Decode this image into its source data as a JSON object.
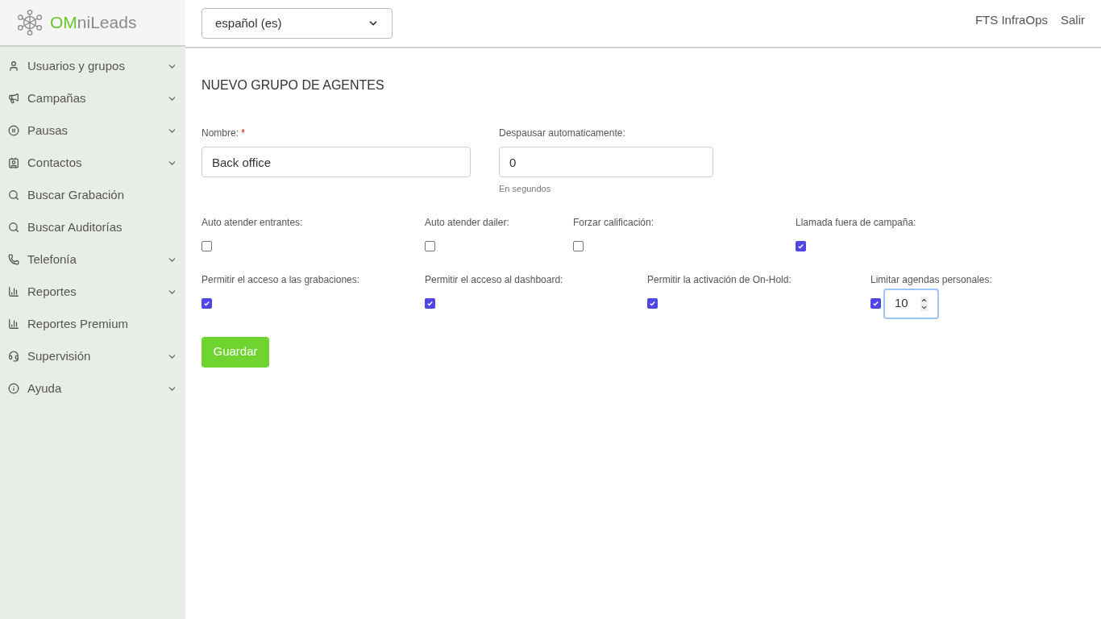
{
  "logo": {
    "accent": "OM",
    "rest": "niLeads"
  },
  "language_select": {
    "value": "español (es)"
  },
  "top_links": [
    "FTS InfraOps",
    "Salir"
  ],
  "sidebar": {
    "items": [
      {
        "label": "Usuarios y grupos",
        "expandable": true
      },
      {
        "label": "Campañas",
        "expandable": true
      },
      {
        "label": "Pausas",
        "expandable": true
      },
      {
        "label": "Contactos",
        "expandable": true
      },
      {
        "label": "Buscar Grabación",
        "expandable": false
      },
      {
        "label": "Buscar Auditorías",
        "expandable": false
      },
      {
        "label": "Telefonía",
        "expandable": true
      },
      {
        "label": "Reportes",
        "expandable": true
      },
      {
        "label": "Reportes Premium",
        "expandable": false
      },
      {
        "label": "Supervisión",
        "expandable": true
      },
      {
        "label": "Ayuda",
        "expandable": true
      }
    ]
  },
  "form": {
    "title": "NUEVO GRUPO DE AGENTES",
    "name_field": {
      "label": "Nombre:",
      "required_mark": "*",
      "value": "Back office"
    },
    "unpause_field": {
      "label": "Despausar automaticamente:",
      "value": "0",
      "help": "En segundos"
    },
    "checkbox_rows": [
      [
        {
          "label": "Auto atender entrantes:",
          "checked": false
        },
        {
          "label": "Auto atender dailer:",
          "checked": false
        },
        {
          "label": "Forzar calificación:",
          "checked": false
        },
        {
          "label": "Llamada fuera de campaña:",
          "checked": true
        }
      ],
      [
        {
          "label": "Permitir el acceso a las grabaciones:",
          "checked": true
        },
        {
          "label": "Permitir el acceso al dashboard:",
          "checked": true
        },
        {
          "label": "Permitir la activación de On-Hold:",
          "checked": true
        },
        {
          "label": "Limitar agendas personales:",
          "checked": true,
          "number": "10"
        }
      ]
    ],
    "submit": "Guardar"
  }
}
